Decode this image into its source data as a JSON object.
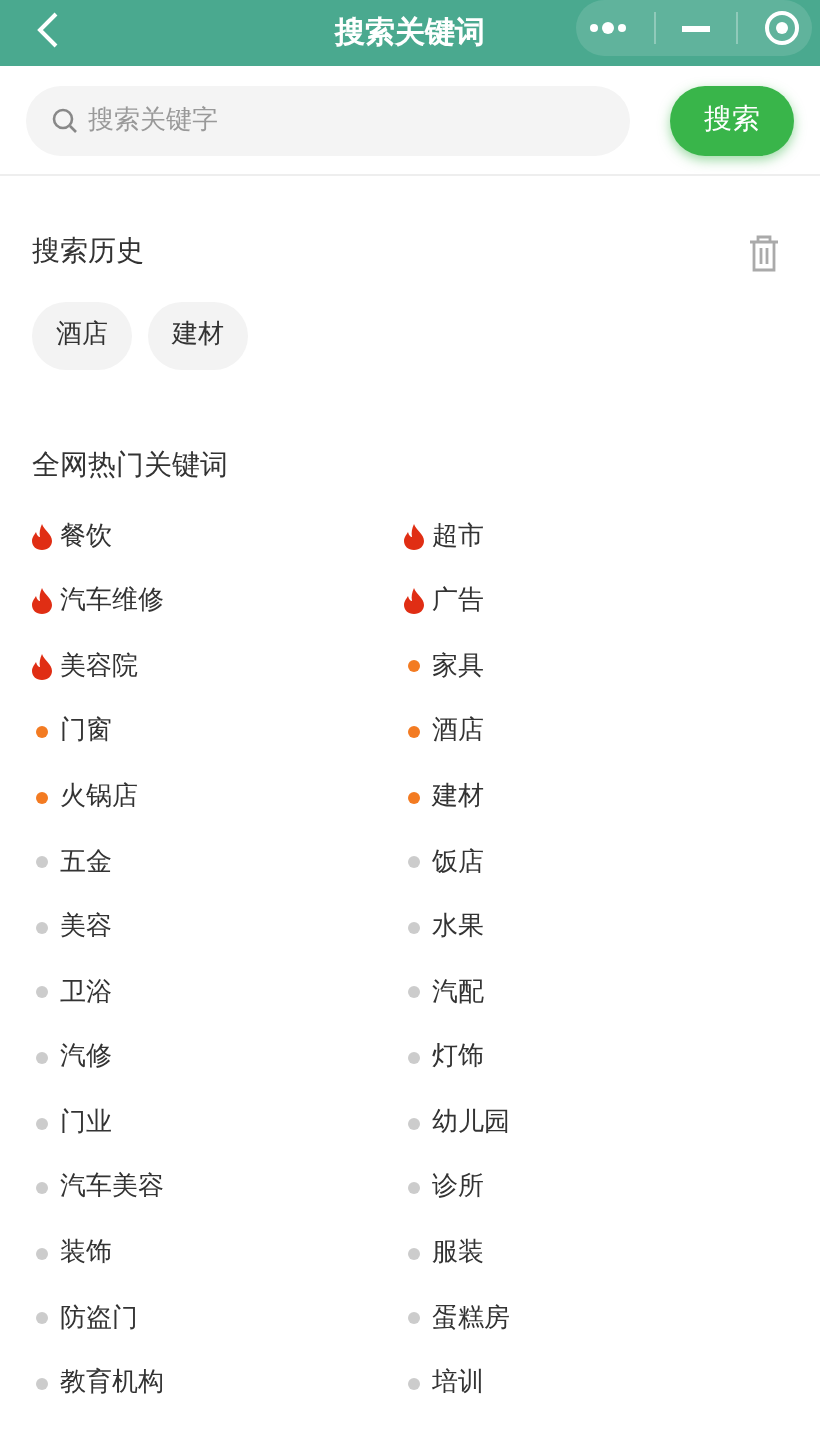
{
  "header": {
    "title": "搜索关键词"
  },
  "search": {
    "placeholder": "搜索关键字",
    "button": "搜索"
  },
  "history": {
    "title": "搜索历史",
    "tags": [
      "酒店",
      "建材"
    ]
  },
  "hot": {
    "title": "全网热门关键词",
    "items": [
      {
        "label": "餐饮",
        "kind": "hot"
      },
      {
        "label": "超市",
        "kind": "hot"
      },
      {
        "label": "汽车维修",
        "kind": "hot"
      },
      {
        "label": "广告",
        "kind": "hot"
      },
      {
        "label": "美容院",
        "kind": "hot"
      },
      {
        "label": "家具",
        "kind": "dot",
        "color": "#f37b22"
      },
      {
        "label": "门窗",
        "kind": "dot",
        "color": "#f37b22"
      },
      {
        "label": "酒店",
        "kind": "dot",
        "color": "#f37b22"
      },
      {
        "label": "火锅店",
        "kind": "dot",
        "color": "#f37b22"
      },
      {
        "label": "建材",
        "kind": "dot",
        "color": "#f37b22"
      },
      {
        "label": "五金",
        "kind": "dot",
        "color": "#cccccc"
      },
      {
        "label": "饭店",
        "kind": "dot",
        "color": "#cccccc"
      },
      {
        "label": "美容",
        "kind": "dot",
        "color": "#cccccc"
      },
      {
        "label": "水果",
        "kind": "dot",
        "color": "#cccccc"
      },
      {
        "label": "卫浴",
        "kind": "dot",
        "color": "#cccccc"
      },
      {
        "label": "汽配",
        "kind": "dot",
        "color": "#cccccc"
      },
      {
        "label": "汽修",
        "kind": "dot",
        "color": "#cccccc"
      },
      {
        "label": "灯饰",
        "kind": "dot",
        "color": "#cccccc"
      },
      {
        "label": "门业",
        "kind": "dot",
        "color": "#cccccc"
      },
      {
        "label": "幼儿园",
        "kind": "dot",
        "color": "#cccccc"
      },
      {
        "label": "汽车美容",
        "kind": "dot",
        "color": "#cccccc"
      },
      {
        "label": "诊所",
        "kind": "dot",
        "color": "#cccccc"
      },
      {
        "label": "装饰",
        "kind": "dot",
        "color": "#cccccc"
      },
      {
        "label": "服装",
        "kind": "dot",
        "color": "#cccccc"
      },
      {
        "label": "防盗门",
        "kind": "dot",
        "color": "#cccccc"
      },
      {
        "label": "蛋糕房",
        "kind": "dot",
        "color": "#cccccc"
      },
      {
        "label": "教育机构",
        "kind": "dot",
        "color": "#cccccc"
      },
      {
        "label": "培训",
        "kind": "dot",
        "color": "#cccccc"
      }
    ]
  }
}
